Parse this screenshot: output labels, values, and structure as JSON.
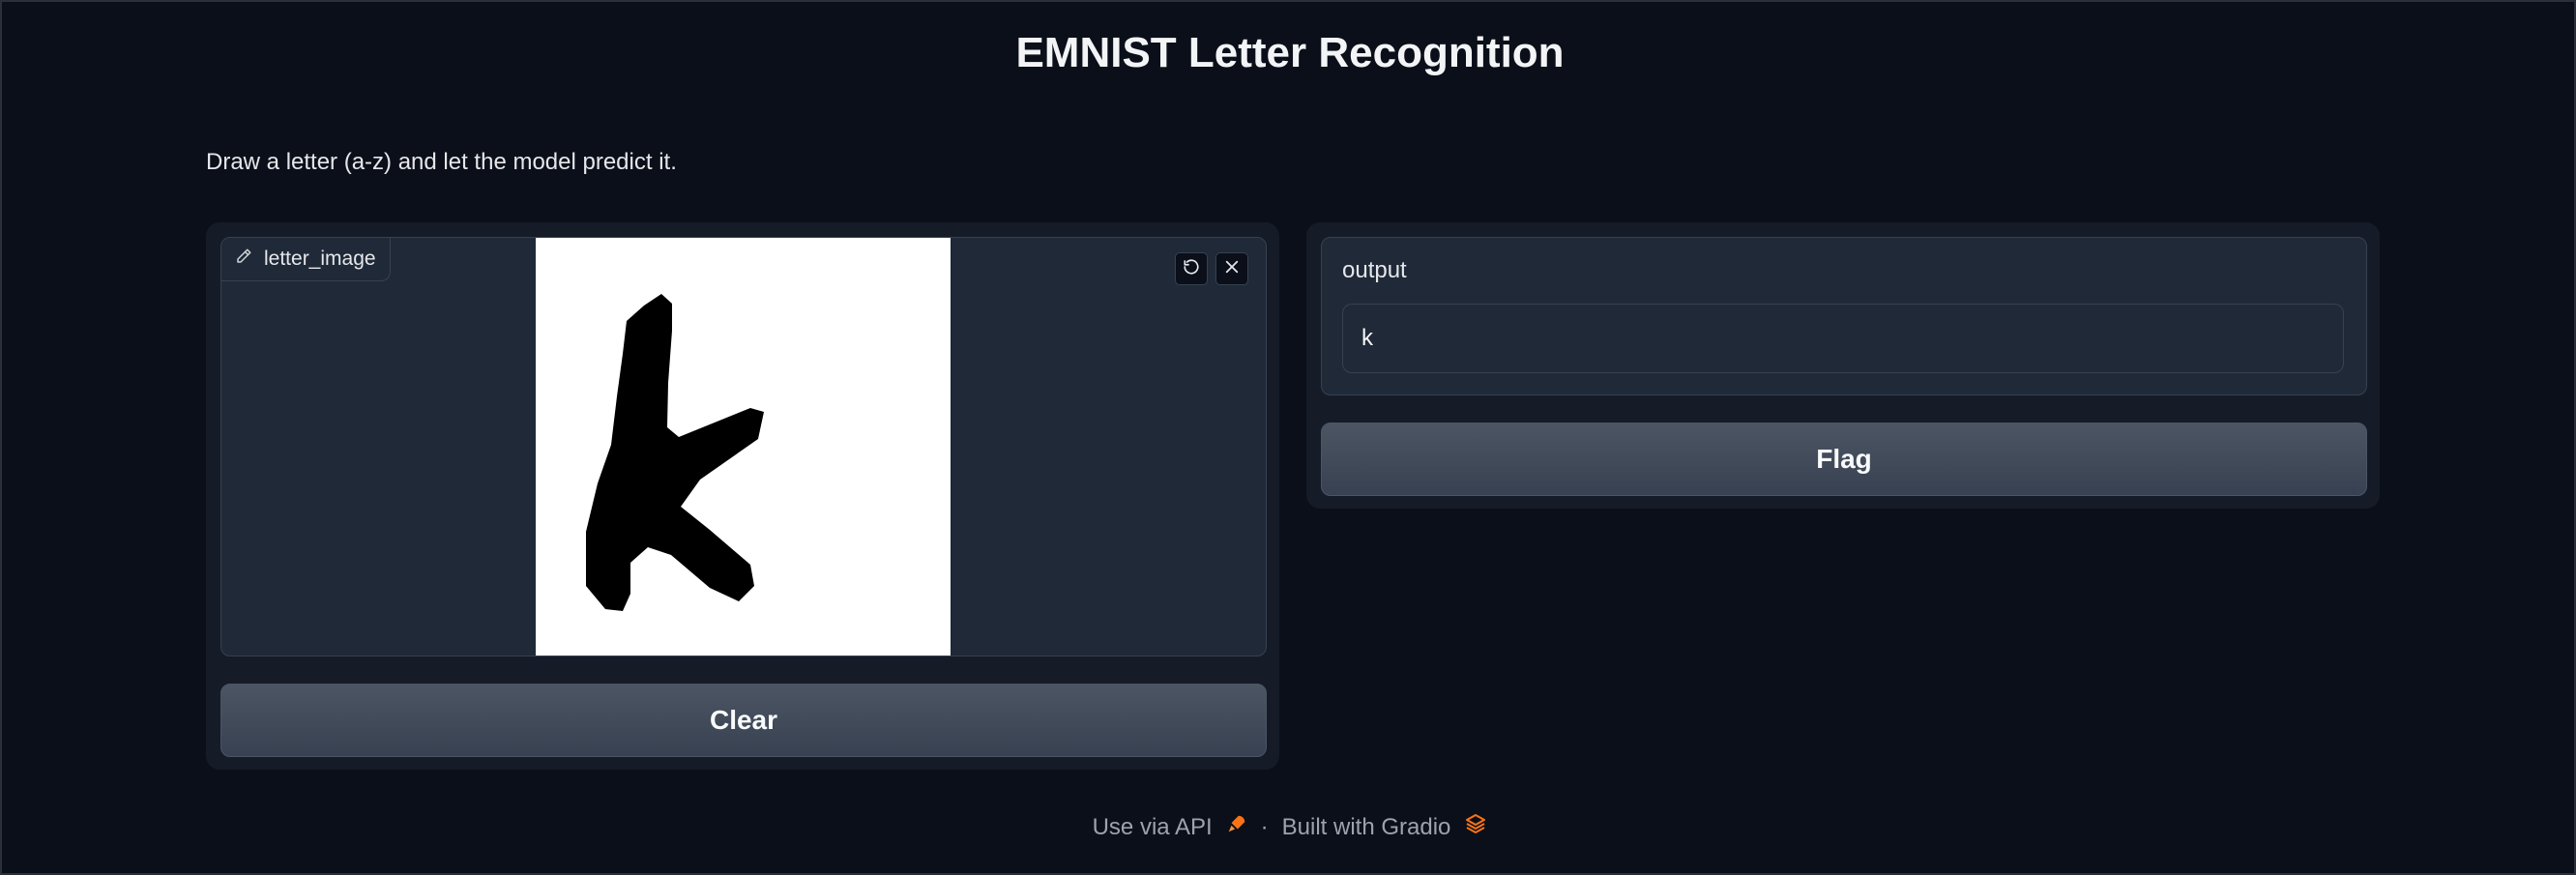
{
  "page": {
    "title": "EMNIST Letter Recognition",
    "description": "Draw a letter (a-z) and let the model predict it."
  },
  "input": {
    "label": "letter_image",
    "label_icon": "pencil-icon",
    "tools": [
      "undo-icon",
      "close-icon"
    ],
    "canvas_background": "#ffffff",
    "stroke_color": "#000000",
    "drawn_letter": "k"
  },
  "buttons": {
    "clear": "Clear",
    "flag": "Flag"
  },
  "output": {
    "label": "output",
    "value": "k"
  },
  "footer": {
    "api": "Use via API",
    "separator": "·",
    "built": "Built with Gradio",
    "accent_color": "#f97316"
  },
  "colors": {
    "background": "#0b0f19",
    "panel": "#151b27",
    "block": "#1f2937",
    "border": "#374151",
    "button": "#4b5563"
  }
}
